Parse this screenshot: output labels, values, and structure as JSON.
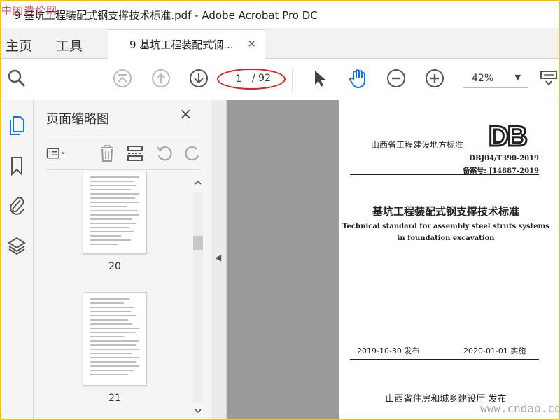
{
  "app": {
    "window_title": "9 基坑工程装配式钢支撑技术标准.pdf - Adobe Acrobat Pro DC",
    "watermark_top_left": "中国造价网",
    "watermark_bottom_right": "www.cndao.com"
  },
  "tabs": {
    "home": "主页",
    "tools": "工具",
    "document": "9 基坑工程装配式钢...",
    "close": "×"
  },
  "toolbar": {
    "page_current": "1",
    "page_total": "/ 92",
    "zoom": "42%",
    "zoom_caret": "▼"
  },
  "panel": {
    "title": "页面缩略图",
    "close": "×",
    "thumbnails": [
      {
        "page": "20"
      },
      {
        "page": "21"
      }
    ]
  },
  "document_page": {
    "agency": "山西省工程建设地方标准",
    "logo": "DB",
    "code": "DBJ04/T390-2019",
    "record": "备案号: J14887-2019",
    "title_cn": "基坑工程装配式钢支撑技术标准",
    "title_en_line1": "Technical standard for assembly steel struts systems",
    "title_en_line2": "in foundation excavation",
    "issue_date": "2019-10-30 发布",
    "effective_date": "2020-01-01 实施",
    "issuer": "山西省住房和城乡建设厅   发布"
  },
  "colors": {
    "accent_blue": "#1473e6",
    "annotation_red": "#e02020",
    "frame_yellow": "#f0c020",
    "doc_background": "#9a9a9a"
  }
}
